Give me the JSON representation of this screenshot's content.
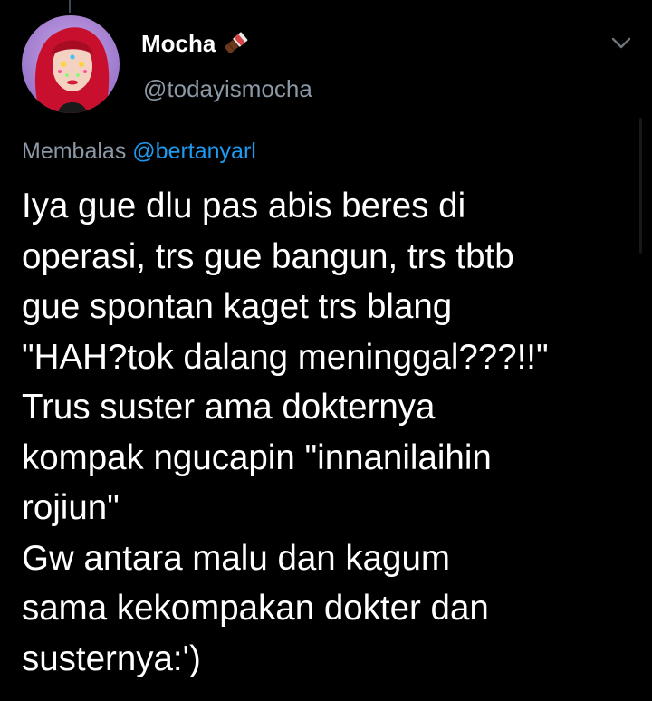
{
  "tweet": {
    "display_name": "Mocha",
    "name_emoji": "chocolate-bar-icon",
    "handle": "@todayismocha",
    "reply_prefix": "Membalas",
    "reply_to": "@bertanyarl",
    "text_lines": [
      "Iya gue dlu pas abis beres di",
      "operasi, trs gue bangun, trs tbtb",
      "gue spontan kaget trs blang",
      "\"HAH?tok dalang meninggal???!!\"",
      "Trus suster ama dokternya",
      "kompak ngucapin \"innanilaihin",
      "rojiun\"",
      "Gw antara malu dan kagum",
      "sama kekompakan dokter dan",
      "susternya:')"
    ],
    "more_icon": "chevron-down-icon"
  },
  "theme": {
    "background": "#000000",
    "text_primary": "#ffffff",
    "text_secondary": "#8b98a5",
    "accent": "#1d9bf0"
  }
}
